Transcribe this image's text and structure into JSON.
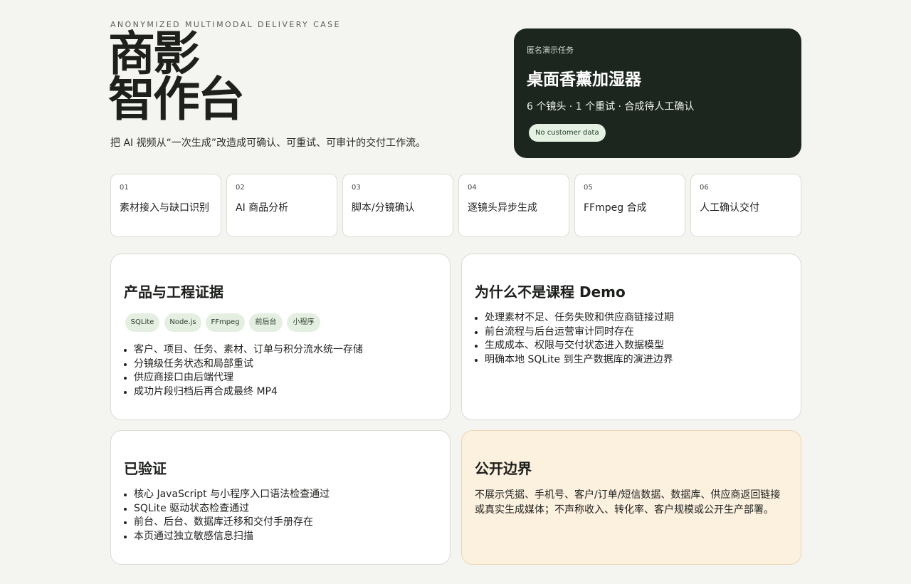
{
  "eyebrow": "ANONYMIZED MULTIMODAL DELIVERY CASE",
  "brand": {
    "line1": "商影",
    "line2": "智作台"
  },
  "tagline": "把 AI 视频从“一次生成”改造成可确认、可重试、可审计的交付工作流。",
  "hero": {
    "kicker": "匿名演示任务",
    "title": "桌面香薰加湿器",
    "subtitle": "6 个镜头 · 1 个重试 · 合成待人工确认",
    "badge": "No customer data"
  },
  "steps": [
    {
      "num": "01",
      "label": "素材接入与缺口识别"
    },
    {
      "num": "02",
      "label": "AI 商品分析"
    },
    {
      "num": "03",
      "label": "脚本/分镜确认"
    },
    {
      "num": "04",
      "label": "逐镜头异步生成"
    },
    {
      "num": "05",
      "label": "FFmpeg 合成"
    },
    {
      "num": "06",
      "label": "人工确认交付"
    }
  ],
  "evidence": {
    "title": "产品与工程证据",
    "chips": [
      "SQLite",
      "Node.js",
      "FFmpeg",
      "前后台",
      "小程序"
    ],
    "items": [
      "客户、项目、任务、素材、订单与积分流水统一存储",
      "分镜级任务状态和局部重试",
      "供应商接口由后端代理",
      "成功片段归档后再合成最终 MP4"
    ]
  },
  "why": {
    "title": "为什么不是课程 Demo",
    "items": [
      "处理素材不足、任务失败和供应商链接过期",
      "前台流程与后台运营审计同时存在",
      "生成成本、权限与交付状态进入数据模型",
      "明确本地 SQLite 到生产数据库的演进边界"
    ]
  },
  "verified": {
    "title": "已验证",
    "items": [
      "核心 JavaScript 与小程序入口语法检查通过",
      "SQLite 驱动状态检查通过",
      "前台、后台、数据库迁移和交付手册存在",
      "本页通过独立敏感信息扫描"
    ]
  },
  "boundary": {
    "title": "公开边界",
    "text": "不展示凭据、手机号、客户/订单/短信数据、数据库、供应商返回链接或真实生成媒体；不声称收入、转化率、客户规模或公开生产部署。"
  },
  "colors": {
    "background": "#f4f4f0",
    "hero_bg": "#1c261f",
    "chip_bg": "#e4efe1",
    "boundary_bg": "#fcf0df"
  }
}
